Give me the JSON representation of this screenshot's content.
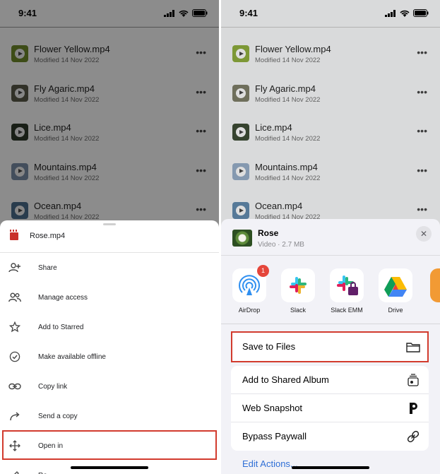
{
  "left": {
    "status": {
      "time": "9:41"
    },
    "files": [
      {
        "name": "Flower Yellow.mp4",
        "date": "Modified 14 Nov 2022",
        "thumb": "#6f8b2a"
      },
      {
        "name": "Fly Agaric.mp4",
        "date": "Modified 14 Nov 2022",
        "thumb": "#5a5a4a"
      },
      {
        "name": "Lice.mp4",
        "date": "Modified 14 Nov 2022",
        "thumb": "#2e3a2a"
      },
      {
        "name": "Mountains.mp4",
        "date": "Modified 14 Nov 2022",
        "thumb": "#7a8fa8"
      },
      {
        "name": "Ocean.mp4",
        "date": "Modified 14 Nov 2022",
        "thumb": "#4b6e8c"
      }
    ],
    "sheet": {
      "filename": "Rose.mp4",
      "items": [
        {
          "label": "Share",
          "icon": "add-person-icon"
        },
        {
          "label": "Manage access",
          "icon": "people-icon"
        },
        {
          "label": "Add to Starred",
          "icon": "star-icon"
        },
        {
          "label": "Make available offline",
          "icon": "offline-check-icon"
        },
        {
          "label": "Copy link",
          "icon": "link-icon"
        },
        {
          "label": "Send a copy",
          "icon": "forward-arrow-icon"
        },
        {
          "label": "Open in",
          "icon": "move-arrows-icon"
        }
      ],
      "partial_item": "Re"
    }
  },
  "right": {
    "status": {
      "time": "9:41"
    },
    "files": [
      {
        "name": "Flower Yellow.mp4",
        "date": "Modified 14 Nov 2022",
        "thumb": "#8aa83c"
      },
      {
        "name": "Fly Agaric.mp4",
        "date": "Modified 14 Nov 2022",
        "thumb": "#7b7a66"
      },
      {
        "name": "Lice.mp4",
        "date": "Modified 14 Nov 2022",
        "thumb": "#3c4a34"
      },
      {
        "name": "Mountains.mp4",
        "date": "Modified 14 Nov 2022",
        "thumb": "#93a9c2"
      },
      {
        "name": "Ocean.mp4",
        "date": "Modified 14 Nov 2022",
        "thumb": "#5f86a8"
      }
    ],
    "share": {
      "title": "Rose",
      "subtitle": "Video · 2.7 MB",
      "close": "✕",
      "apps": [
        {
          "label": "AirDrop",
          "badge": "1",
          "icon": "airdrop-icon"
        },
        {
          "label": "Slack",
          "icon": "slack-icon"
        },
        {
          "label": "Slack EMM",
          "icon": "slack-emm-icon"
        },
        {
          "label": "Drive",
          "icon": "google-drive-icon"
        }
      ],
      "primary_action": {
        "label": "Save to Files",
        "icon": "folder-icon"
      },
      "actions": [
        {
          "label": "Add to Shared Album",
          "icon": "shared-album-icon"
        },
        {
          "label": "Web Snapshot",
          "icon": "p-logo-icon"
        },
        {
          "label": "Bypass Paywall",
          "icon": "link-icon"
        }
      ],
      "edit_actions": "Edit Actions..."
    }
  },
  "colors": {
    "highlight": "#d23b2e",
    "link": "#2f6fd6",
    "badge": "#e5463b"
  }
}
